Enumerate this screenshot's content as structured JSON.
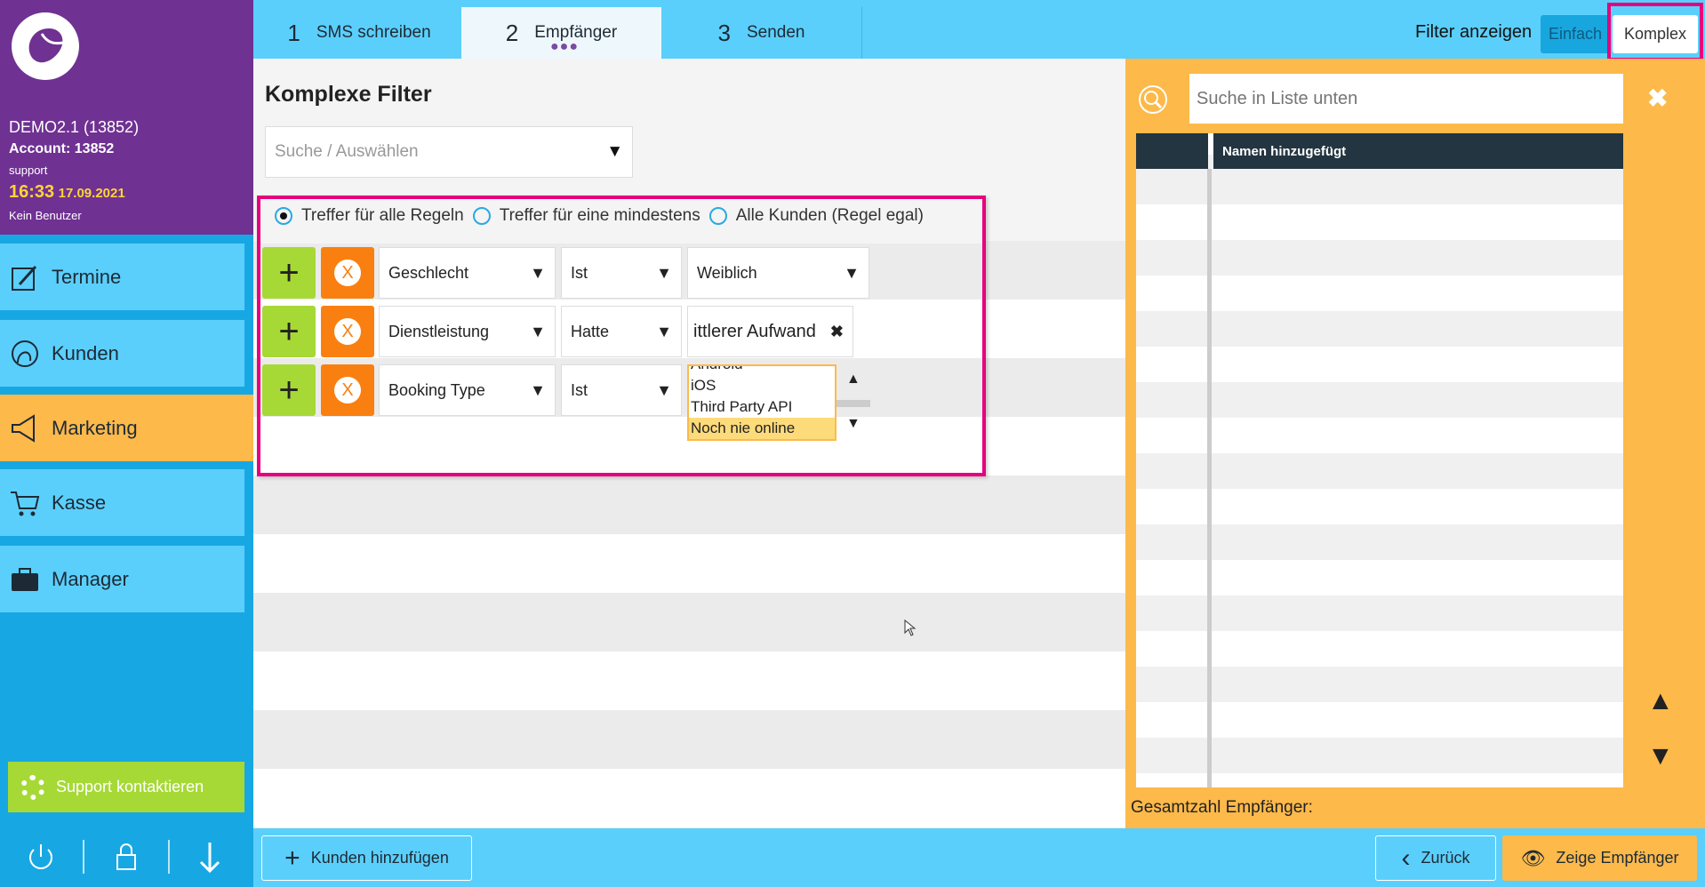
{
  "sidebar": {
    "account_name": "DEMO2.1 (13852)",
    "account": "Account: 13852",
    "user": "support",
    "time": "16:33",
    "date": "17.09.2021",
    "no_user": "Kein Benutzer",
    "items": [
      {
        "label": "Termine",
        "icon": "calendar-edit-icon"
      },
      {
        "label": "Kunden",
        "icon": "customer-icon"
      },
      {
        "label": "Marketing",
        "icon": "megaphone-icon",
        "active": true
      },
      {
        "label": "Kasse",
        "icon": "cart-icon"
      },
      {
        "label": "Manager",
        "icon": "briefcase-icon"
      }
    ],
    "support": "Support kontaktieren"
  },
  "tabs": [
    {
      "num": "1",
      "label": "SMS schreiben"
    },
    {
      "num": "2",
      "label": "Empfänger",
      "active": true
    },
    {
      "num": "3",
      "label": "Senden"
    }
  ],
  "filter_toggle": {
    "label": "Filter anzeigen",
    "simple": "Einfach",
    "complex": "Komplex",
    "selected": "Komplex"
  },
  "main": {
    "title": "Komplexe Filter",
    "search_placeholder": "Suche / Auswählen",
    "match_options": [
      "Treffer für alle Regeln",
      "Treffer für eine mindestens",
      "Alle Kunden (Regel egal)"
    ],
    "match_selected": 0,
    "rules": [
      {
        "field": "Geschlecht",
        "op": "Ist",
        "value": "Weiblich"
      },
      {
        "field": "Dienstleistung",
        "op": "Hatte",
        "value": "ittlerer Aufwand"
      },
      {
        "field": "Booking Type",
        "op": "Ist",
        "options": [
          "Android",
          "iOS",
          "Third Party API",
          "Noch nie online"
        ],
        "selected": "Noch nie online"
      }
    ]
  },
  "right": {
    "search_placeholder": "Suche in Liste unten",
    "column": "Namen hinzugefügt",
    "total_label": "Gesamtzahl Empfänger:"
  },
  "bottom": {
    "add": "Kunden hinzufügen",
    "back": "Zurück",
    "show": "Zeige Empfänger"
  },
  "colors": {
    "purple": "#6f3192",
    "sky": "#5bcffb",
    "orange": "#fdb94a",
    "green": "#a6d935",
    "highlight": "#e6007e"
  }
}
